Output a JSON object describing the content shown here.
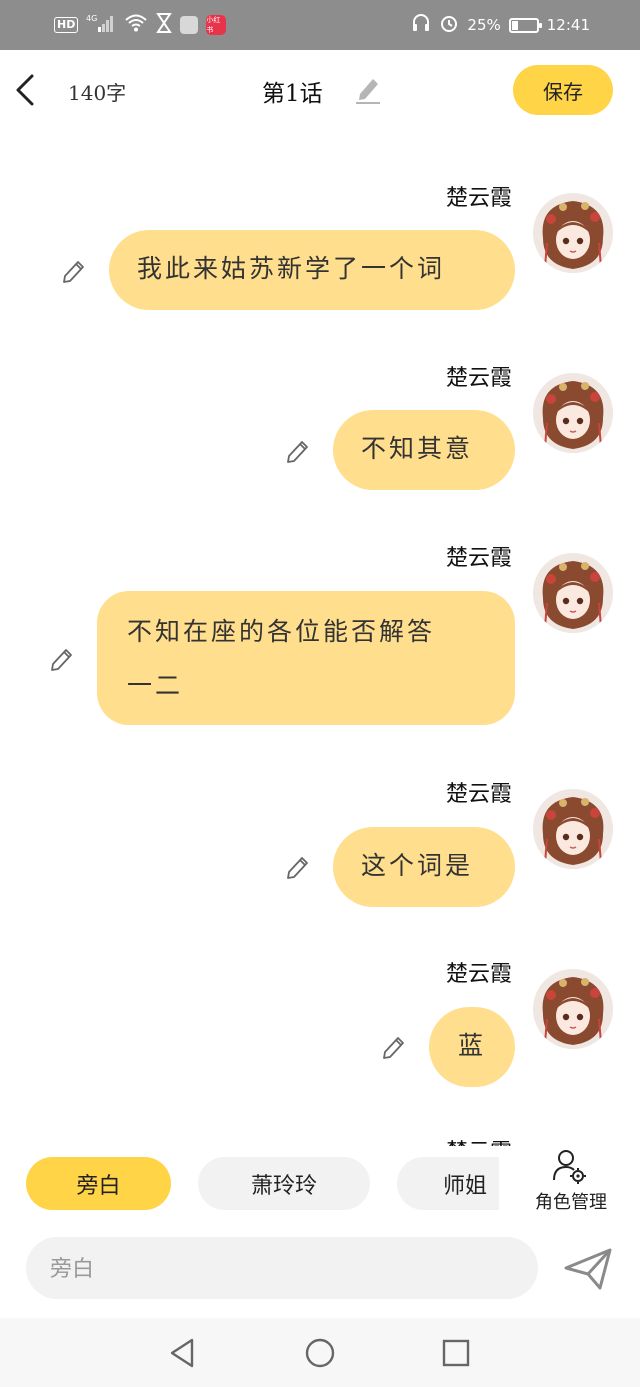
{
  "status_bar": {
    "hd": "HD",
    "network": "4G",
    "red_app_text": "小红书",
    "battery_percent": "25%",
    "time": "12:41",
    "icons": [
      "signal-icon",
      "wifi-icon",
      "hourglass-icon",
      "mail-icon",
      "headphone-icon",
      "alarm-icon",
      "battery-icon"
    ]
  },
  "header": {
    "back_icon": "chevron-left-icon",
    "word_count": "140字",
    "chapter_title": "第1话",
    "edit_icon": "pencil-icon",
    "save_label": "保存"
  },
  "messages": [
    {
      "speaker": "楚云霞",
      "text": "我此来姑苏新学了一个词"
    },
    {
      "speaker": "楚云霞",
      "text": "不知其意"
    },
    {
      "speaker": "楚云霞",
      "lines": [
        "不知在座的各位能否解答",
        "一二"
      ]
    },
    {
      "speaker": "楚云霞",
      "text": "这个词是"
    },
    {
      "speaker": "楚云霞",
      "text": "蓝"
    },
    {
      "speaker": "楚云霞",
      "text": ""
    }
  ],
  "characters": {
    "chips": [
      "旁白",
      "萧玲玲",
      "师姐"
    ],
    "active_index": 0,
    "manage_label": "角色管理",
    "manage_icon": "user-gear-icon"
  },
  "input": {
    "placeholder": "旁白",
    "value": "",
    "send_icon": "send-icon"
  },
  "nav": {
    "icons": [
      "back-triangle-icon",
      "home-circle-icon",
      "recents-square-icon"
    ]
  },
  "colors": {
    "accent": "#ffd447",
    "bubble": "#ffdf8e",
    "status_bar": "#8d8d8d"
  }
}
